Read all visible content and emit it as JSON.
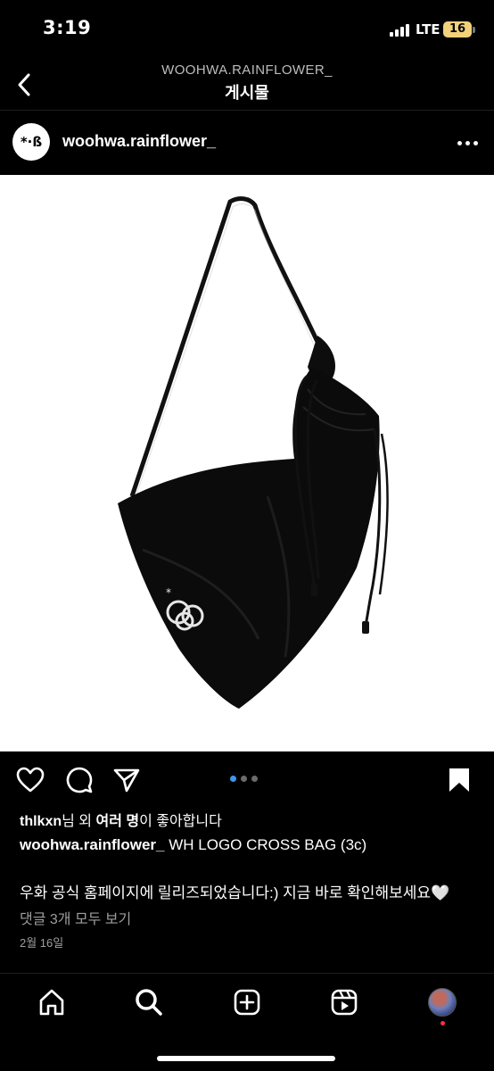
{
  "status_bar": {
    "time": "3:19",
    "network": "LTE",
    "battery": "16",
    "battery_color": "#f2d17a"
  },
  "header": {
    "account_caps": "WOOHWA.RAINFLOWER_",
    "title": "게시물",
    "back_icon": "chevron-left-icon"
  },
  "post": {
    "avatar_text": "*·ß",
    "username": "woohwa.rainflower_",
    "more_icon": "more-horizontal-icon",
    "image_alt": "black drawstring cross bag with white logo",
    "carousel": {
      "count": 3,
      "active": 1,
      "active_color": "#3d97f0"
    },
    "likes": {
      "user": "thlkxn",
      "middle": "님 외 ",
      "others": "여러 명",
      "suffix": "이 좋아합니다"
    },
    "caption": {
      "user": "woohwa.rainflower_",
      "text": "WH LOGO CROSS BAG (3c)"
    },
    "body": "우화 공식 홈페이지에 릴리즈되었습니다:) 지금 바로 확인해보세요🤍",
    "comments": "댓글 3개 모두 보기",
    "date": "2월 16일"
  },
  "actions": {
    "like_icon": "heart-icon",
    "comment_icon": "comment-icon",
    "share_icon": "send-icon",
    "save_icon": "bookmark-icon"
  },
  "tabbar": {
    "items": [
      "home-icon",
      "search-icon",
      "create-icon",
      "reels-icon",
      "profile-avatar"
    ]
  }
}
